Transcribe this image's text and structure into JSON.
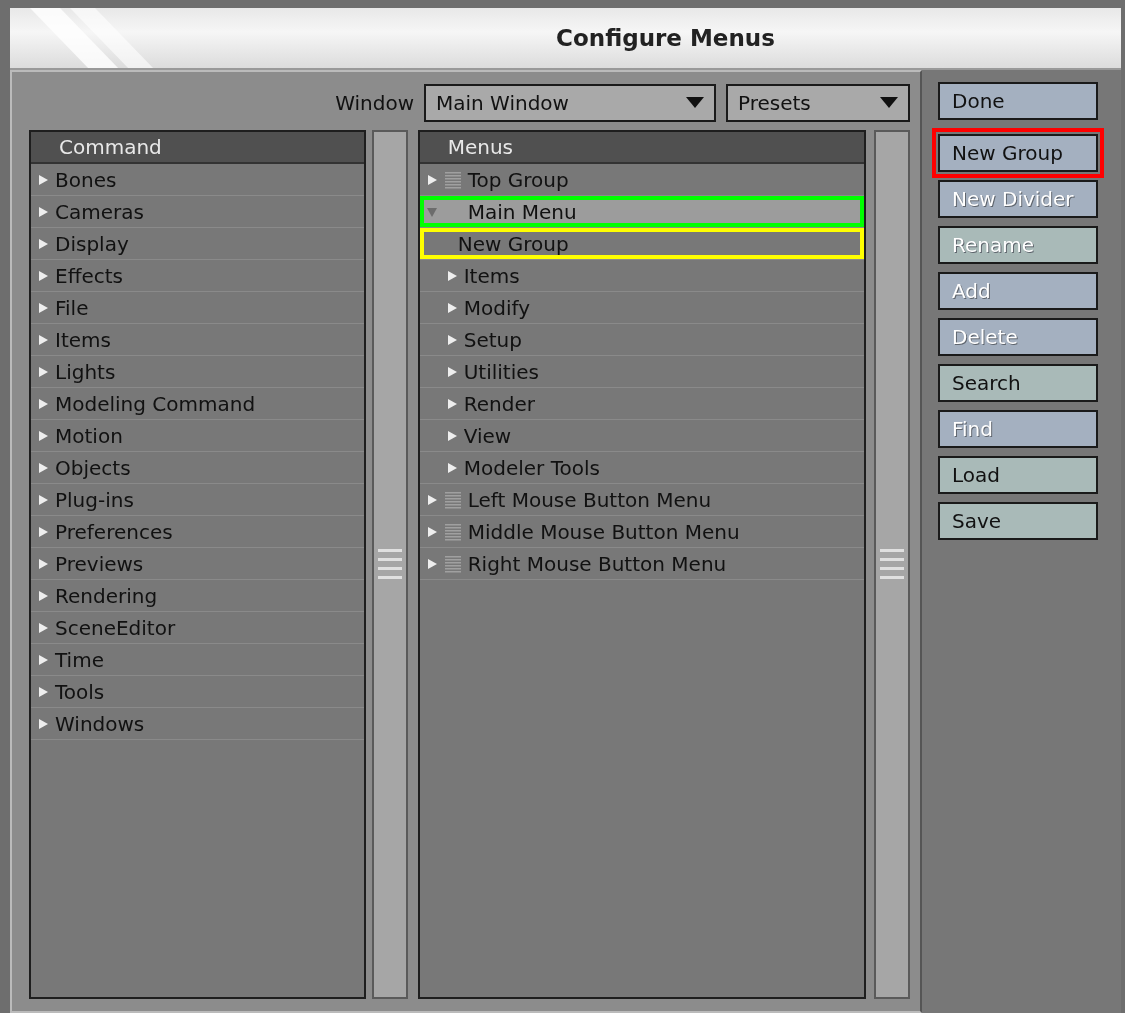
{
  "window": {
    "title": "Configure Menus"
  },
  "toolbar": {
    "window_label": "Window",
    "window_select": "Main Window",
    "presets_select": "Presets"
  },
  "commands": {
    "header": "Command",
    "items": [
      {
        "label": "Bones",
        "expanded": false
      },
      {
        "label": "Cameras",
        "expanded": false
      },
      {
        "label": "Display",
        "expanded": false
      },
      {
        "label": "Effects",
        "expanded": false
      },
      {
        "label": "File",
        "expanded": false
      },
      {
        "label": "Items",
        "expanded": false
      },
      {
        "label": "Lights",
        "expanded": false
      },
      {
        "label": "Modeling Command",
        "expanded": false
      },
      {
        "label": "Motion",
        "expanded": false
      },
      {
        "label": "Objects",
        "expanded": false
      },
      {
        "label": "Plug-ins",
        "expanded": false
      },
      {
        "label": "Preferences",
        "expanded": false
      },
      {
        "label": "Previews",
        "expanded": false
      },
      {
        "label": "Rendering",
        "expanded": false
      },
      {
        "label": "SceneEditor",
        "expanded": false
      },
      {
        "label": "Time",
        "expanded": false
      },
      {
        "label": "Tools",
        "expanded": false
      },
      {
        "label": "Windows",
        "expanded": false
      }
    ]
  },
  "menus": {
    "header": "Menus",
    "items": [
      {
        "label": "Top Group",
        "kind": "group",
        "expanded": false,
        "selected": false
      },
      {
        "label": "Main Menu",
        "kind": "menu",
        "expanded": true,
        "selected": true,
        "color": "#00ff00",
        "children": [
          {
            "label": "New Group",
            "kind": "leaf",
            "selected": false,
            "color": "#ffff00"
          },
          {
            "label": "Items",
            "kind": "menu",
            "expanded": false,
            "selected": false
          },
          {
            "label": "Modify",
            "kind": "menu",
            "expanded": false,
            "selected": false
          },
          {
            "label": "Setup",
            "kind": "menu",
            "expanded": false,
            "selected": false
          },
          {
            "label": "Utilities",
            "kind": "menu",
            "expanded": false,
            "selected": false
          },
          {
            "label": "Render",
            "kind": "menu",
            "expanded": false,
            "selected": false
          },
          {
            "label": "View",
            "kind": "menu",
            "expanded": false,
            "selected": false
          },
          {
            "label": "Modeler Tools",
            "kind": "menu",
            "expanded": false,
            "selected": false
          }
        ]
      },
      {
        "label": "Left Mouse Button Menu",
        "kind": "group",
        "expanded": false,
        "selected": false
      },
      {
        "label": "Middle Mouse Button Menu",
        "kind": "group",
        "expanded": false,
        "selected": false
      },
      {
        "label": "Right Mouse Button Menu",
        "kind": "group",
        "expanded": false,
        "selected": false
      }
    ]
  },
  "buttons": [
    {
      "label": "Done",
      "disabled": false,
      "kind": "edit"
    },
    {
      "label": "New Group",
      "disabled": false,
      "kind": "edit",
      "color": "#ff0000"
    },
    {
      "label": "New Divider",
      "disabled": true,
      "kind": "edit"
    },
    {
      "label": "Rename",
      "disabled": true,
      "kind": "file"
    },
    {
      "label": "Add",
      "disabled": true,
      "kind": "edit"
    },
    {
      "label": "Delete",
      "disabled": true,
      "kind": "edit"
    },
    {
      "label": "Search",
      "disabled": false,
      "kind": "file"
    },
    {
      "label": "Find",
      "disabled": true,
      "kind": "edit"
    },
    {
      "label": "Load",
      "disabled": false,
      "kind": "file"
    },
    {
      "label": "Save",
      "disabled": false,
      "kind": "file"
    }
  ]
}
